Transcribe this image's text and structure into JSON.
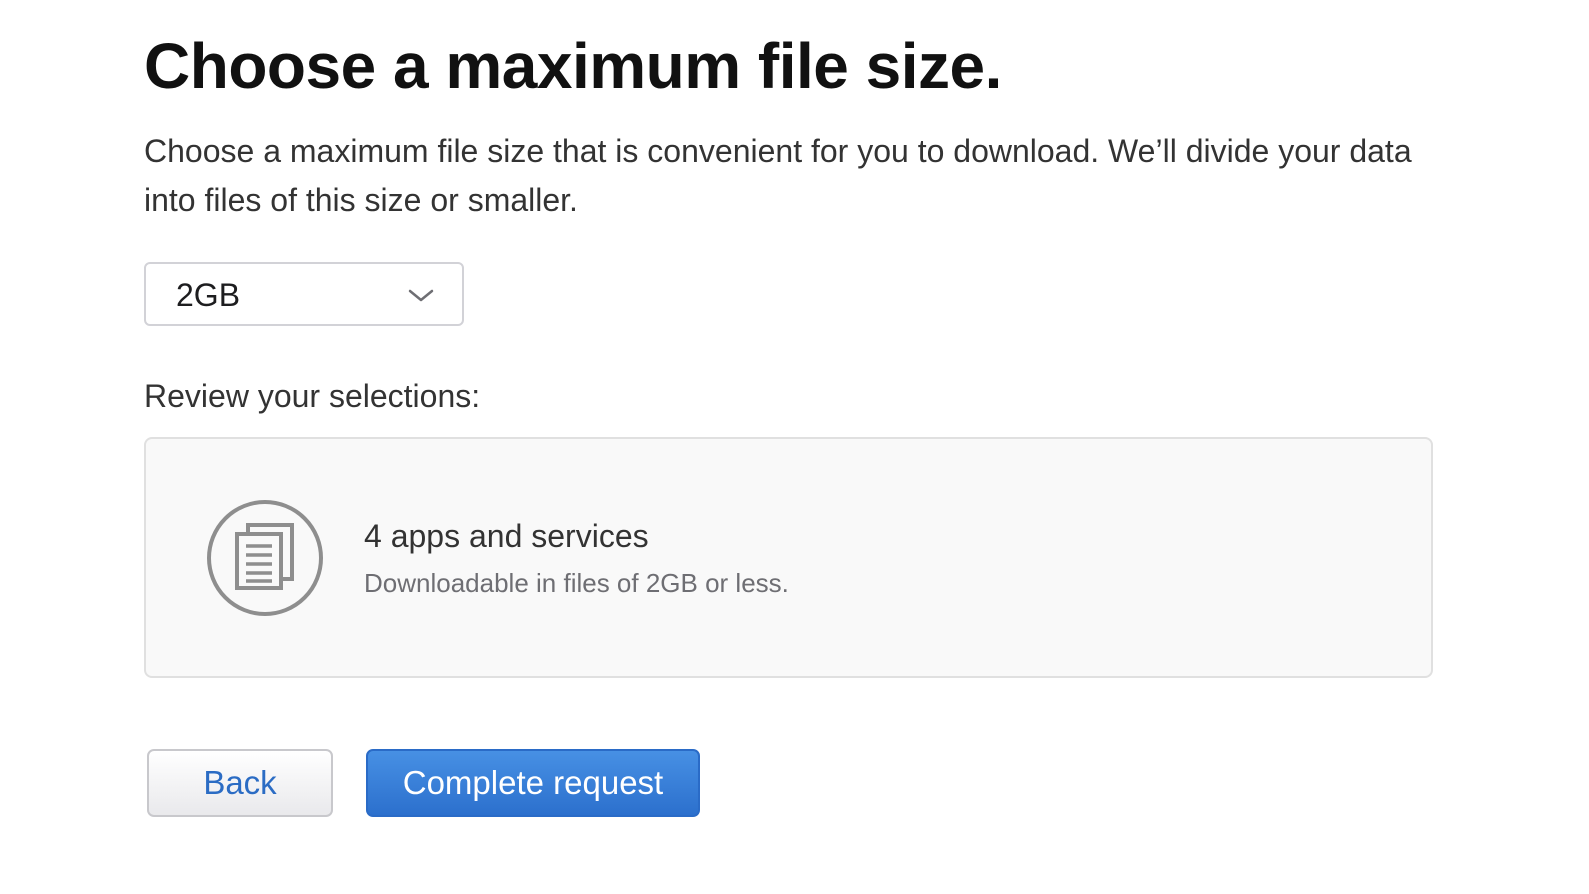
{
  "page": {
    "title": "Choose a maximum file size.",
    "description": "Choose a maximum file size that is convenient for you to download. We’ll divide your data into files of this size or smaller."
  },
  "file_size_select": {
    "selected": "2GB",
    "icon": "chevron-down-icon"
  },
  "review": {
    "label": "Review your selections:",
    "card": {
      "icon": "documents-icon",
      "title": "4 apps and services",
      "subtitle": "Downloadable in files of 2GB or less."
    }
  },
  "actions": {
    "back_label": "Back",
    "complete_label": "Complete request"
  },
  "colors": {
    "accent": "#2c70cd",
    "link": "#2b6cc4",
    "card_background": "#f9f9f9",
    "icon_gray": "#8e8e8e"
  }
}
